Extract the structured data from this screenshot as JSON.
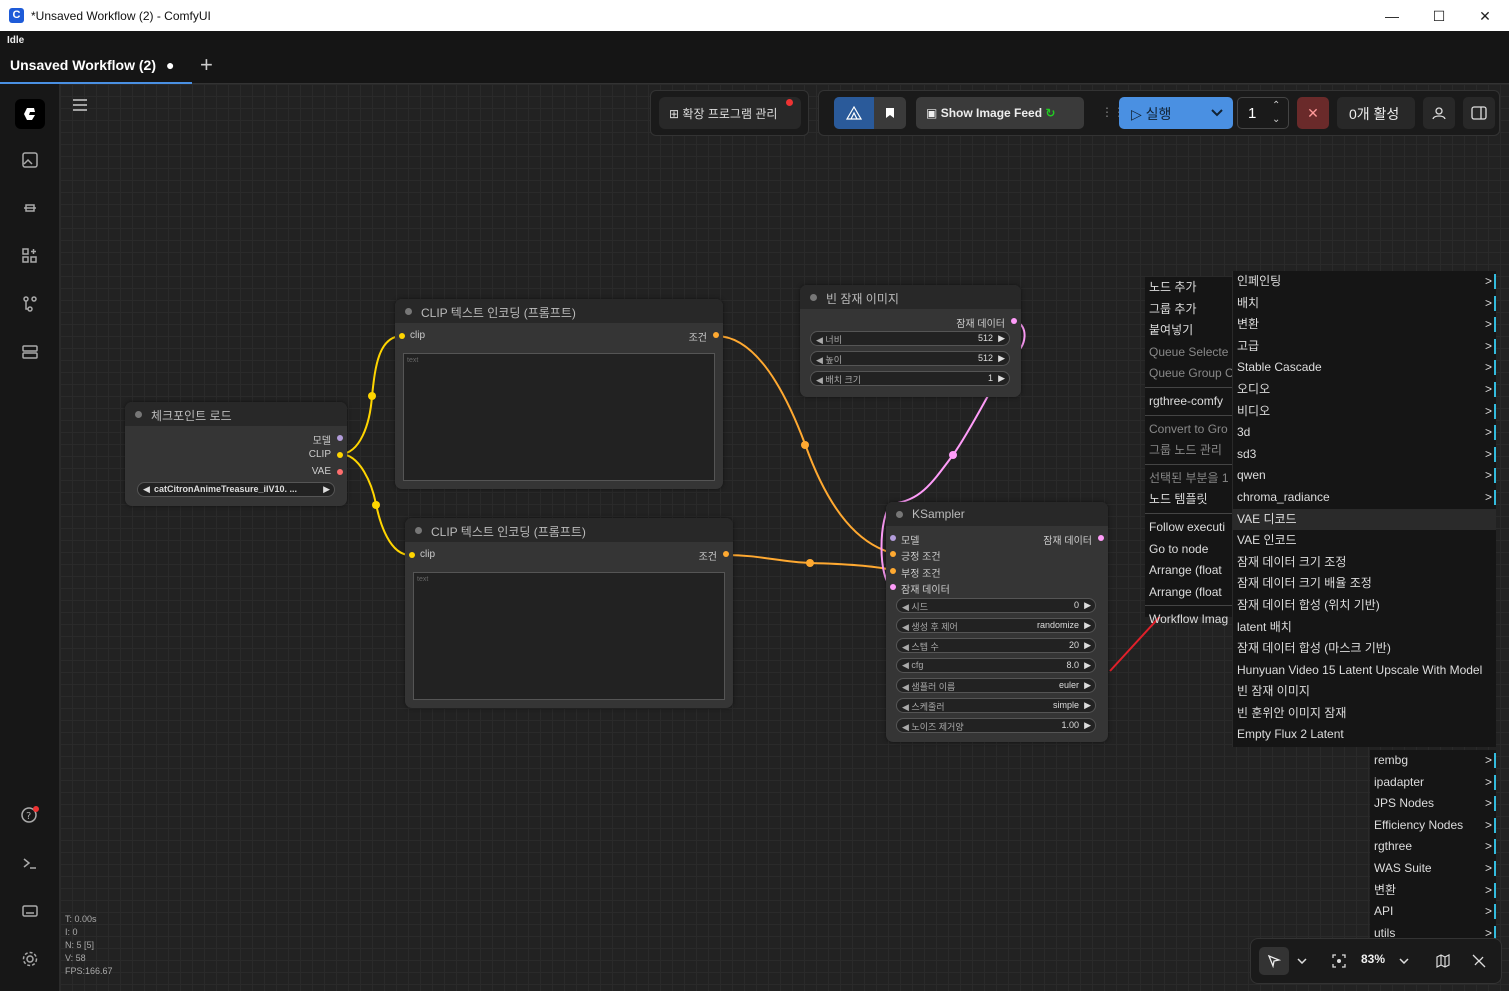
{
  "window": {
    "title": "*Unsaved Workflow (2) - ComfyUI",
    "minimize": "—",
    "maximize": "☐",
    "close": "✕"
  },
  "status": "Idle",
  "tab": {
    "label": "Unsaved Workflow (2)",
    "modified_dot": "●",
    "new_tab": "+"
  },
  "toolbar": {
    "extensions": "확장 프로그램 관리",
    "show_image_feed": "Show Image Feed",
    "run": "실행",
    "queue_count": "1",
    "active": "0개 활성"
  },
  "nodes": {
    "checkpoint": {
      "title": "체크포인트 로드",
      "out_model": "모델",
      "out_clip": "CLIP",
      "out_vae": "VAE",
      "ckpt": "catCitronAnimeTreasure_ilV10. ..."
    },
    "clip1": {
      "title": "CLIP 텍스트 인코딩 (프롬프트)",
      "in_clip": "clip",
      "out": "조건",
      "placeholder": "text"
    },
    "clip2": {
      "title": "CLIP 텍스트 인코딩 (프롬프트)",
      "in_clip": "clip",
      "out": "조건",
      "placeholder": "text"
    },
    "empty_latent": {
      "title": "빈 잠재 이미지",
      "out": "잠재 데이터",
      "w_label": "너비",
      "w_val": "512",
      "h_label": "높이",
      "h_val": "512",
      "b_label": "배치 크기",
      "b_val": "1"
    },
    "ksampler": {
      "title": "KSampler",
      "out": "잠재 데이터",
      "in_model": "모델",
      "in_pos": "긍정 조건",
      "in_neg": "부정 조건",
      "in_latent": "잠재 데이터",
      "widgets": [
        {
          "label": "시드",
          "value": "0"
        },
        {
          "label": "생성 후 제어",
          "value": "randomize"
        },
        {
          "label": "스텝 수",
          "value": "20"
        },
        {
          "label": "cfg",
          "value": "8.0"
        },
        {
          "label": "샘플러 이름",
          "value": "euler"
        },
        {
          "label": "스케줄러",
          "value": "simple"
        },
        {
          "label": "노이즈 제거양",
          "value": "1.00"
        }
      ]
    }
  },
  "context_menu": [
    {
      "label": "노드 추가"
    },
    {
      "label": "그룹 추가"
    },
    {
      "label": "붙여넣기"
    },
    {
      "label": "Queue Selecte"
    },
    {
      "label": "Queue Group C"
    },
    {
      "label": "rgthree-comfy"
    },
    {
      "label": "Convert to Gro"
    },
    {
      "label": "그룹 노드 관리"
    },
    {
      "label": "선택된 부분을 1"
    },
    {
      "label": "노드 템플릿"
    },
    {
      "label": "Follow executi"
    },
    {
      "label": "Go to node"
    },
    {
      "label": "Arrange (float"
    },
    {
      "label": "Arrange (float"
    },
    {
      "label": "Workflow Imag"
    }
  ],
  "submenu": [
    "인페인팅",
    "배치",
    "변환",
    "고급",
    "Stable Cascade",
    "오디오",
    "비디오",
    "3d",
    "sd3",
    "qwen",
    "chroma_radiance"
  ],
  "latent_items": [
    "VAE 디코드",
    "VAE 인코드",
    "잠재 데이터 크기 조정",
    "잠재 데이터 크기 배율 조정",
    "잠재 데이터 합성 (위치 기반)",
    "latent 배치",
    "잠재 데이터 합성 (마스크 기반)",
    "Hunyuan Video 15 Latent Upscale With Model",
    "빈 잠재 이미지",
    "빈 훈위안 이미지 잠재",
    "Empty Flux 2 Latent"
  ],
  "category_items": [
    "rembg",
    "ipadapter",
    "JPS Nodes",
    "Efficiency Nodes",
    "rgthree",
    "WAS Suite",
    "변환",
    "API",
    "utils"
  ],
  "stats": [
    "T: 0.00s",
    "I: 0",
    "N: 5 [5]",
    "V: 58",
    "FPS:166.67"
  ],
  "zoom": "83%",
  "colors": {
    "accent": "#4a90e2",
    "clip_link": "#ffd500",
    "cond_link": "#ffa931",
    "latent_link": "#ff9cf9",
    "annotation_arrow": "#e0202a"
  }
}
